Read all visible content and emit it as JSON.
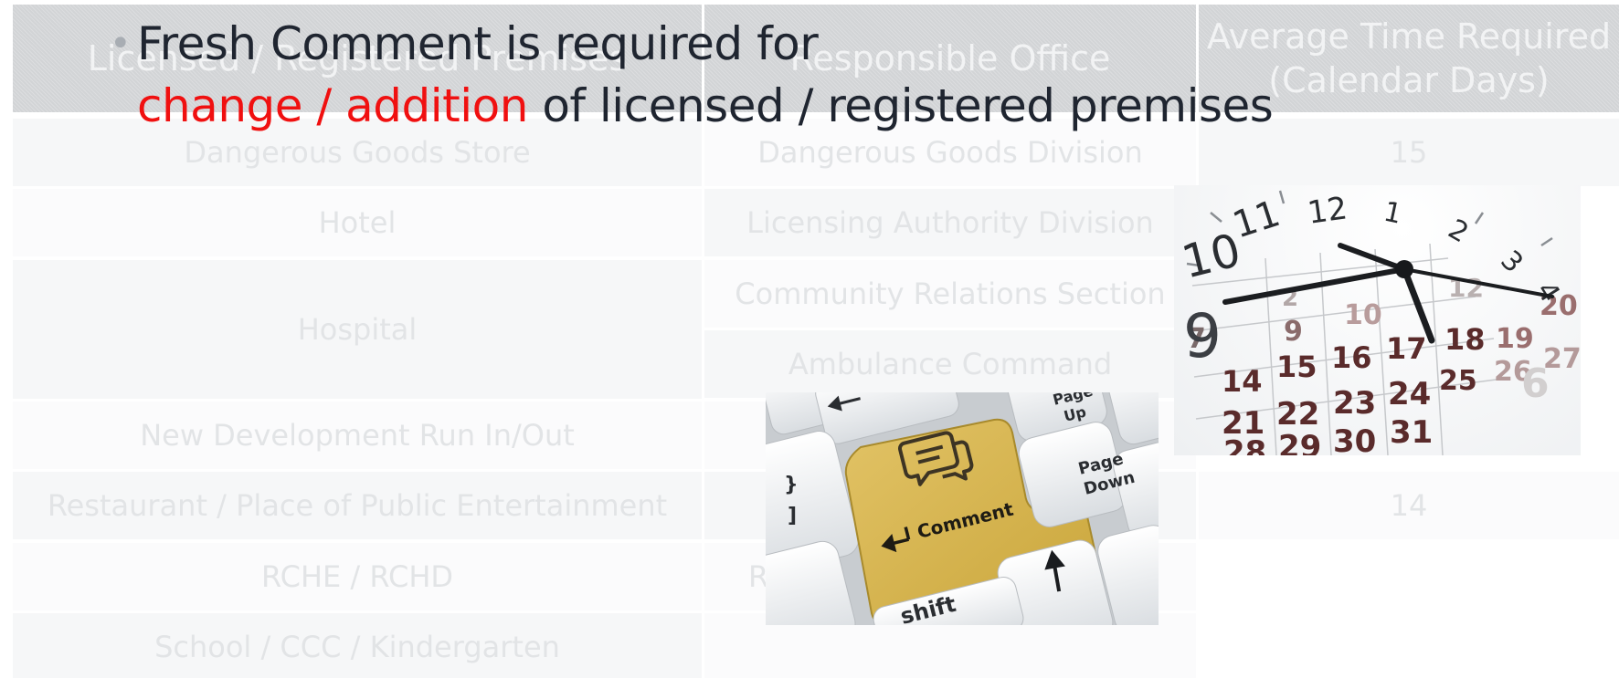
{
  "table": {
    "headers": [
      {
        "line1": "Licensed / Registered Premises",
        "line2": ""
      },
      {
        "line1": "Responsible Office",
        "line2": ""
      },
      {
        "line1": "Average Time Required",
        "line2": "(Calendar Days)"
      }
    ],
    "col1": [
      "Dangerous Goods Store",
      "Hotel",
      "Hospital",
      "New Development Run In/Out",
      "Restaurant  / Place of Public Entertainment",
      "RCHE / RCHD",
      "School  / CCC / Kindergarten"
    ],
    "col2": [
      "Dangerous Goods Division",
      "Licensing Authority Division",
      "Community Relations Section",
      "Ambulance Command",
      "Re"
    ],
    "col3": [
      "15",
      "14"
    ]
  },
  "bullet": {
    "part1": "Fresh Comment is required for",
    "highlight": "change / addition",
    "part2": " of licensed / registered premises"
  },
  "clock_image": {
    "dial_numbers": [
      "11",
      "12",
      "1",
      "2",
      "3",
      "4",
      "10",
      "9"
    ],
    "calendar_numbers": [
      "7",
      "2",
      "9",
      "10",
      "12",
      "19",
      "20",
      "14",
      "15",
      "16",
      "17",
      "18",
      "25",
      "26",
      "27",
      "21",
      "22",
      "23",
      "24",
      "30",
      "31",
      "28",
      "29",
      "6"
    ]
  },
  "keyboard_image": {
    "comment_key": "Comment",
    "pgup_top": "Page",
    "pgup_bottom": "Up",
    "pgdn_top": "Page",
    "pgdn_bottom": "Down",
    "brace": "}",
    "bracket": "]",
    "shift": "shift"
  }
}
